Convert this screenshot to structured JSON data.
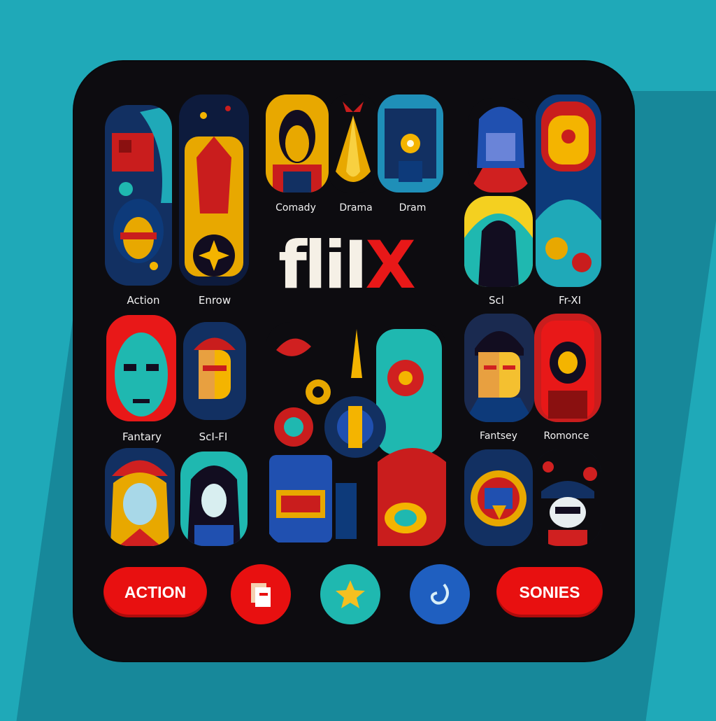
{
  "app": {
    "logo_part1": "fliI",
    "logo_part2": "X"
  },
  "tiles": {
    "left_top": [
      "Action",
      "Enrow"
    ],
    "center_top": [
      "Comady",
      "Drama",
      "Dram"
    ],
    "right_top": [
      "Scl",
      "Fr-XI"
    ],
    "left_mid": [
      "Fantary",
      "ScI-FI"
    ],
    "right_mid": [
      "Fantsey",
      "Romonce"
    ]
  },
  "buttons": {
    "action_label": "ACTION",
    "files_icon": "files-icon",
    "star_icon": "star-icon",
    "hook_icon": "hook-icon",
    "series_label": "SONIES"
  },
  "colors": {
    "background": "#1fa9b8",
    "panel": "#0d0c10",
    "accent_red": "#e81010",
    "teal": "#1fb8b0",
    "blue": "#1f5fc0",
    "gold": "#f4b400"
  }
}
